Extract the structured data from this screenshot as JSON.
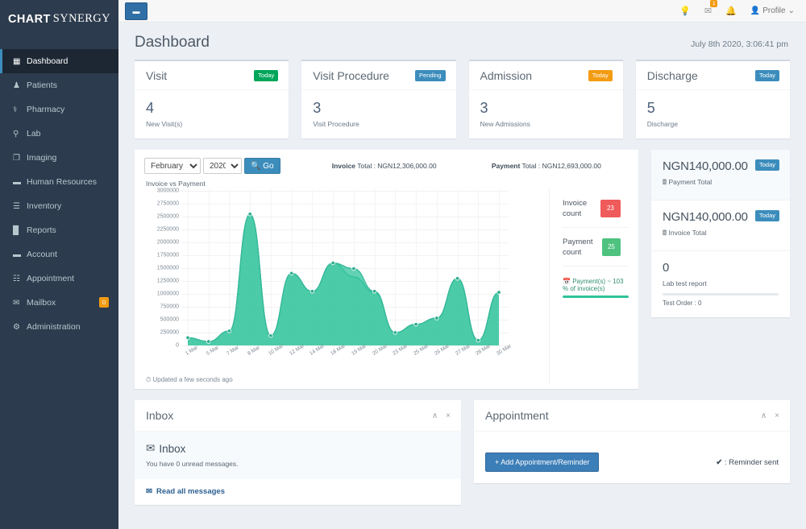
{
  "brand": {
    "part1": "CHART",
    "part2": "SYNERGY"
  },
  "sidebar": {
    "items": [
      {
        "label": "Dashboard",
        "icon": "grid-icon",
        "glyph": "▦",
        "active": true
      },
      {
        "label": "Patients",
        "icon": "users-icon",
        "glyph": "♟",
        "active": false
      },
      {
        "label": "Pharmacy",
        "icon": "briefcase-medical-icon",
        "glyph": "⚕",
        "active": false
      },
      {
        "label": "Lab",
        "icon": "flask-icon",
        "glyph": "⚲",
        "active": false
      },
      {
        "label": "Imaging",
        "icon": "image-file-icon",
        "glyph": "❐",
        "active": false
      },
      {
        "label": "Human Resources",
        "icon": "suitcase-icon",
        "glyph": "▬",
        "active": false
      },
      {
        "label": "Inventory",
        "icon": "list-icon",
        "glyph": "☰",
        "active": false
      },
      {
        "label": "Reports",
        "icon": "bar-chart-icon",
        "glyph": "█",
        "active": false
      },
      {
        "label": "Account",
        "icon": "wallet-icon",
        "glyph": "▬",
        "active": false
      },
      {
        "label": "Appointment",
        "icon": "calendar-icon",
        "glyph": "☷",
        "active": false
      },
      {
        "label": "Mailbox",
        "icon": "envelope-icon",
        "glyph": "✉",
        "active": false,
        "badge": "0"
      },
      {
        "label": "Administration",
        "icon": "cogs-icon",
        "glyph": "⚙",
        "active": false
      }
    ]
  },
  "topbar": {
    "toggle_glyph": "↔",
    "lightbulb_icon": "Ὂ1",
    "messages_badge": "1",
    "profile_label": "Profile",
    "profile_caret": "⌄"
  },
  "header": {
    "title": "Dashboard",
    "datetime": "July 8th 2020, 3:06:41 pm"
  },
  "stats": [
    {
      "title": "Visit",
      "pill": "Today",
      "pill_color": "#00a65a",
      "value": "4",
      "sub": "New Visit(s)"
    },
    {
      "title": "Visit Procedure",
      "pill": "Pending",
      "pill_color": "#3c8dbc",
      "value": "3",
      "sub": "Visit Procedure"
    },
    {
      "title": "Admission",
      "pill": "Today",
      "pill_color": "#f39c12",
      "value": "3",
      "sub": "New Admissions"
    },
    {
      "title": "Discharge",
      "pill": "Today",
      "pill_color": "#3c8dbc",
      "value": "5",
      "sub": "Discharge"
    }
  ],
  "chart_panel": {
    "month_selected": "February",
    "year_selected": "2020",
    "go_label": "Go",
    "search_icon": "ὐD",
    "invoice_total": "Invoice Total : NGN12,306,000.00",
    "invoice_total_prefix": "Invoice",
    "payment_total": "Payment Total : NGN12,693,000.00",
    "payment_total_prefix": "Payment",
    "chart_label": "Invoice vs Payment",
    "footer": "Updated a few seconds ago",
    "clock_icon": "◴",
    "invoice_count_label": "Invoice count",
    "invoice_count_value": "23",
    "invoice_count_color": "#ef5a5a",
    "payment_count_label": "Payment count",
    "payment_count_value": "25",
    "payment_count_color": "#4fc27f",
    "pct_text": "Payment(s) ~ 103 % of invoice(s)",
    "pct_icon": "Ὄ5"
  },
  "chart_data": {
    "type": "area",
    "title": "Invoice vs Payment",
    "xlabel": "",
    "ylabel": "",
    "ylim": [
      0,
      3000000
    ],
    "grid": true,
    "legend": "none",
    "ytick_labels": [
      "3000000",
      "2750000",
      "2500000",
      "2250000",
      "2000000",
      "1750000",
      "1500000",
      "1250000",
      "1000000",
      "750000",
      "500000",
      "250000",
      "0"
    ],
    "categories": [
      "1 Mar",
      "5 Mar",
      "7 Mar",
      "8 Mar",
      "10 Mar",
      "12 Mar",
      "14 Mar",
      "18 Mar",
      "19 Mar",
      "20 Mar",
      "23 Mar",
      "25 Mar",
      "26 Mar",
      "27 Mar",
      "28 Mar",
      "30 Mar"
    ],
    "series": [
      {
        "name": "Invoice",
        "color": "#2fc39b",
        "values": [
          150000,
          75000,
          280000,
          2550000,
          190000,
          1400000,
          1050000,
          1600000,
          1490000,
          1050000,
          250000,
          410000,
          530000,
          1300000,
          100000,
          1030000
        ]
      },
      {
        "name": "Payment",
        "color": "#54cdaa",
        "values": [
          150000,
          75000,
          280000,
          2550000,
          190000,
          1400000,
          1050000,
          1600000,
          1330000,
          1030000,
          250000,
          410000,
          530000,
          1300000,
          100000,
          1030000
        ]
      }
    ]
  },
  "side_summary": [
    {
      "amount": "NGN140,000.00",
      "sub": "Payment Total",
      "icon": "calculator-icon",
      "pill": "Today",
      "pill_color": "#3c8dbc",
      "highlight": true
    },
    {
      "amount": "NGN140,000.00",
      "sub": "Invoice Total",
      "icon": "calculator-icon",
      "pill": "Today",
      "pill_color": "#3c8dbc",
      "highlight": false
    }
  ],
  "lab_card": {
    "value": "0",
    "label": "Lab test report",
    "note": "Test Order : 0"
  },
  "inbox_panel": {
    "title": "Inbox",
    "collapse_icon": "∧",
    "close_icon": "×",
    "heading": "Inbox",
    "heading_icon": "✉",
    "message": "You have 0 unread messages.",
    "link": "Read all messages",
    "link_icon": "✉"
  },
  "appointment_panel": {
    "title": "Appointment",
    "collapse_icon": "∧",
    "close_icon": "×",
    "add_button": "Add Appointment/Reminder",
    "add_icon": "+",
    "reminder_legend": ": Reminder sent",
    "reminder_icon": "✔"
  }
}
